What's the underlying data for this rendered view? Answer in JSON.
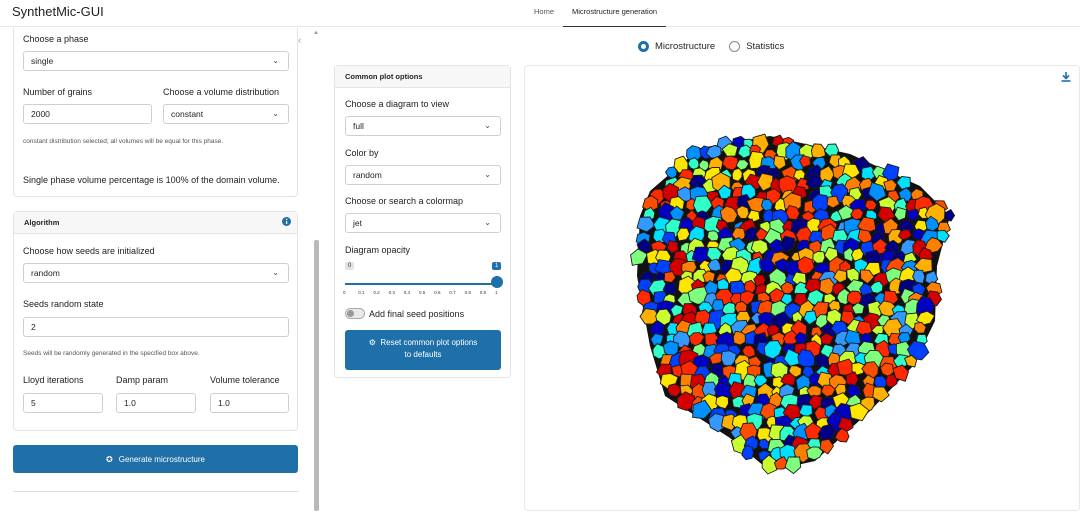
{
  "app": {
    "title": "SynthetMic-GUI"
  },
  "nav": {
    "home": "Home",
    "micro": "Microstructure generation"
  },
  "phase": {
    "choose_label": "Choose a phase",
    "phase_value": "single",
    "grains_label": "Number of grains",
    "grains_value": "2000",
    "vol_dist_label": "Choose a volume distribution",
    "vol_dist_value": "constant",
    "dist_note": "constant distribution selected; all volumes will be equal for this phase.",
    "phase_pct": "Single phase volume percentage is 100% of the domain volume."
  },
  "algorithm": {
    "title": "Algorithm",
    "seeds_init_label": "Choose how seeds are initialized",
    "seeds_init_value": "random",
    "random_state_label": "Seeds random state",
    "random_state_value": "2",
    "seeds_note": "Seeds will be randomly generated in the specified box above.",
    "lloyd_label": "Lloyd iterations",
    "lloyd_value": "5",
    "damp_label": "Damp param",
    "damp_value": "1.0",
    "vol_tol_label": "Volume tolerance",
    "vol_tol_value": "1.0"
  },
  "generate_button": "Generate microstructure",
  "view": {
    "microstructure": "Microstructure",
    "statistics": "Statistics",
    "selected": "Microstructure"
  },
  "plot_options": {
    "title": "Common plot options",
    "diagram_label": "Choose a diagram to view",
    "diagram_value": "full",
    "color_label": "Color by",
    "color_value": "random",
    "cmap_label": "Choose or search a colormap",
    "cmap_value": "jet",
    "opacity_label": "Diagram opacity",
    "opacity_min": "0",
    "opacity_value": "1",
    "opacity_fraction": 1.0,
    "ticks": [
      "0",
      "0.1",
      "0.2",
      "0.3",
      "0.4",
      "0.5",
      "0.6",
      "0.7",
      "0.8",
      "0.9",
      "1"
    ],
    "seed_toggle_label": "Add final seed positions",
    "reset_line1": "Reset common plot options",
    "reset_line2": "to defaults"
  },
  "colors": {
    "accent": "#1f6fa8"
  }
}
